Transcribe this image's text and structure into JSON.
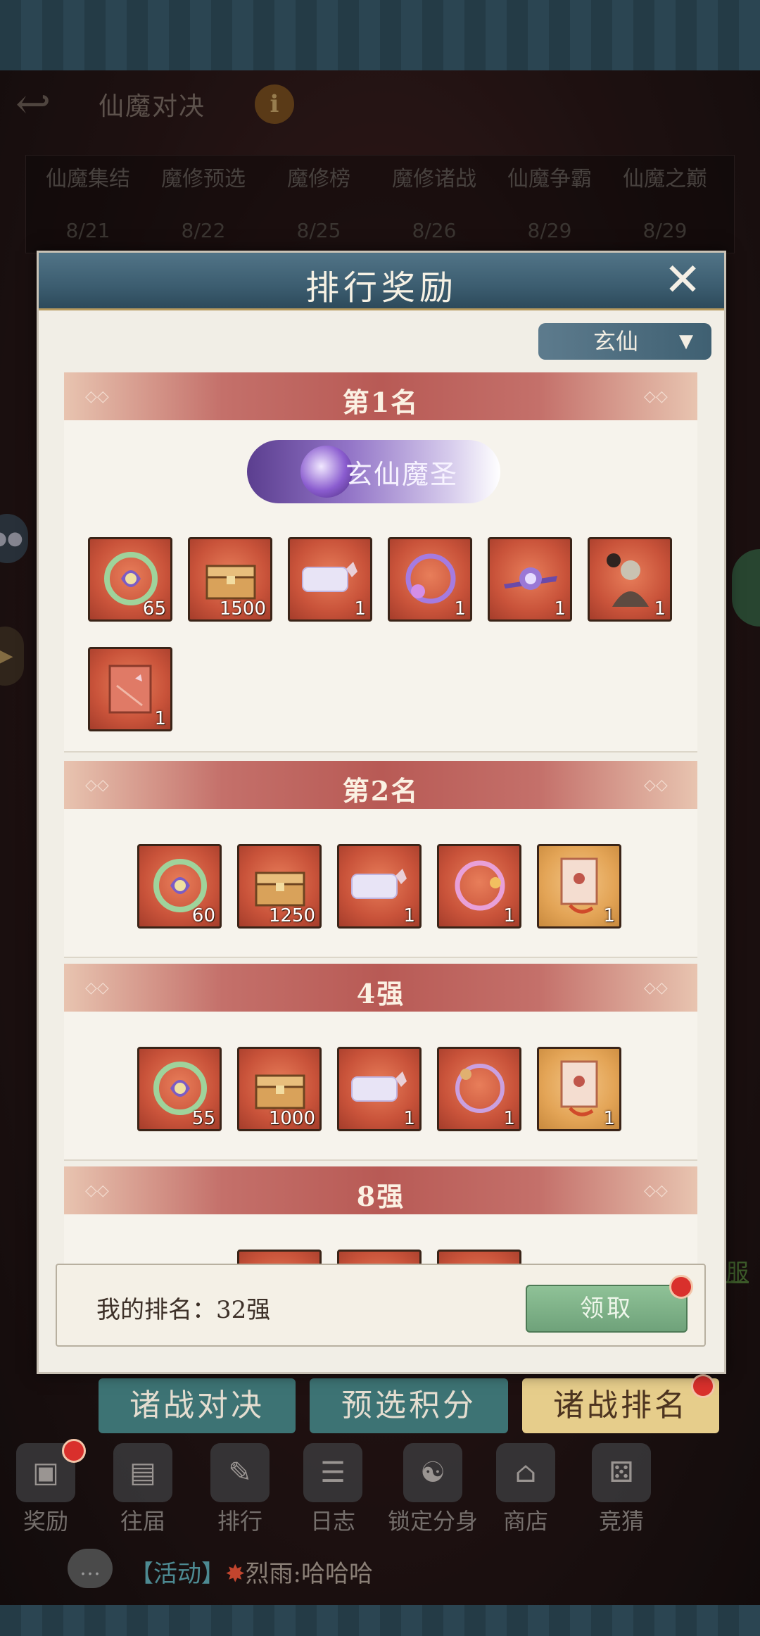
{
  "header": {
    "title": "仙魔对决",
    "info_icon": "info-icon",
    "back_icon": "back-arrow-icon"
  },
  "stages": [
    {
      "label": "仙魔集结",
      "date": "8/21"
    },
    {
      "label": "魔修预选",
      "date": "8/22"
    },
    {
      "label": "魔修榜",
      "date": "8/25"
    },
    {
      "label": "魔修诸战",
      "date": "8/26"
    },
    {
      "label": "仙魔争霸",
      "date": "8/29"
    },
    {
      "label": "仙魔之巅",
      "date": "8/29"
    }
  ],
  "modal": {
    "title": "排行奖励",
    "tier_selected": "玄仙",
    "sections": [
      {
        "title": "第1名",
        "badge": "玄仙魔圣",
        "items": [
          {
            "icon": "spiral-token-icon",
            "count": "65",
            "bg": "red"
          },
          {
            "icon": "treasure-chest-icon",
            "count": "1500",
            "bg": "red"
          },
          {
            "icon": "name-plate-icon",
            "count": "1",
            "bg": "red"
          },
          {
            "icon": "avatar-frame-icon",
            "count": "1",
            "bg": "red"
          },
          {
            "icon": "title-emblem-icon",
            "count": "1",
            "bg": "red"
          },
          {
            "icon": "warrior-portrait-icon",
            "count": "1",
            "bg": "red"
          },
          {
            "icon": "book-icon",
            "count": "1",
            "bg": "red"
          }
        ]
      },
      {
        "title": "第2名",
        "items": [
          {
            "icon": "spiral-token-icon",
            "count": "60",
            "bg": "red"
          },
          {
            "icon": "treasure-chest-icon",
            "count": "1250",
            "bg": "red"
          },
          {
            "icon": "name-plate-icon",
            "count": "1",
            "bg": "red"
          },
          {
            "icon": "avatar-frame-icon",
            "count": "1",
            "bg": "red"
          },
          {
            "icon": "scroll-card-icon",
            "count": "1",
            "bg": "gold"
          }
        ]
      },
      {
        "title": "4强",
        "items": [
          {
            "icon": "spiral-token-icon",
            "count": "55",
            "bg": "red"
          },
          {
            "icon": "treasure-chest-icon",
            "count": "1000",
            "bg": "red"
          },
          {
            "icon": "name-plate-icon",
            "count": "1",
            "bg": "red"
          },
          {
            "icon": "avatar-frame-icon",
            "count": "1",
            "bg": "red"
          },
          {
            "icon": "scroll-card-icon",
            "count": "1",
            "bg": "gold"
          }
        ]
      },
      {
        "title": "8强",
        "items": []
      }
    ],
    "my_rank_label": "我的排名：32强",
    "claim_label": "领取"
  },
  "bottom_tabs": [
    {
      "label": "诸战对决",
      "active": false
    },
    {
      "label": "预选积分",
      "active": false
    },
    {
      "label": "诸战排名",
      "active": true
    }
  ],
  "nav": [
    {
      "label": "奖励",
      "icon": "reward-icon"
    },
    {
      "label": "往届",
      "icon": "history-icon"
    },
    {
      "label": "排行",
      "icon": "ranking-icon"
    },
    {
      "label": "日志",
      "icon": "log-icon"
    },
    {
      "label": "锁定分身",
      "icon": "lock-clone-icon"
    },
    {
      "label": "商店",
      "icon": "shop-icon"
    },
    {
      "label": "竞猜",
      "icon": "dice-icon"
    }
  ],
  "chat": {
    "tag": "【活动】",
    "message": "烈雨:哈哈哈"
  },
  "side_link": "服",
  "colors": {
    "accent_red": "#b85a55",
    "header_blue": "#3c5d70",
    "claim_green": "#6fa27a",
    "active_tab": "#e6cd8b"
  }
}
